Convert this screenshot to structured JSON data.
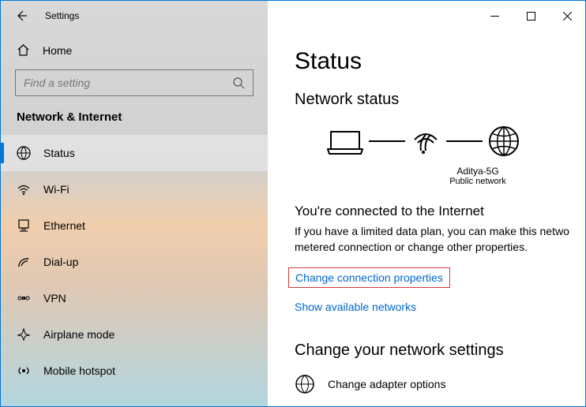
{
  "window": {
    "title": "Settings"
  },
  "sidebar": {
    "home": "Home",
    "search_placeholder": "Find a setting",
    "category": "Network & Internet",
    "items": [
      {
        "label": "Status"
      },
      {
        "label": "Wi-Fi"
      },
      {
        "label": "Ethernet"
      },
      {
        "label": "Dial-up"
      },
      {
        "label": "VPN"
      },
      {
        "label": "Airplane mode"
      },
      {
        "label": "Mobile hotspot"
      }
    ]
  },
  "main": {
    "title": "Status",
    "subtitle": "Network status",
    "connection": {
      "name": "Aditya-5G",
      "type": "Public network"
    },
    "connected_heading": "You're connected to the Internet",
    "connected_desc": "If you have a limited data plan, you can make this netwo metered connection or change other properties.",
    "change_props": "Change connection properties",
    "show_networks": "Show available networks",
    "change_settings_title": "Change your network settings",
    "adapter_options": "Change adapter options"
  }
}
